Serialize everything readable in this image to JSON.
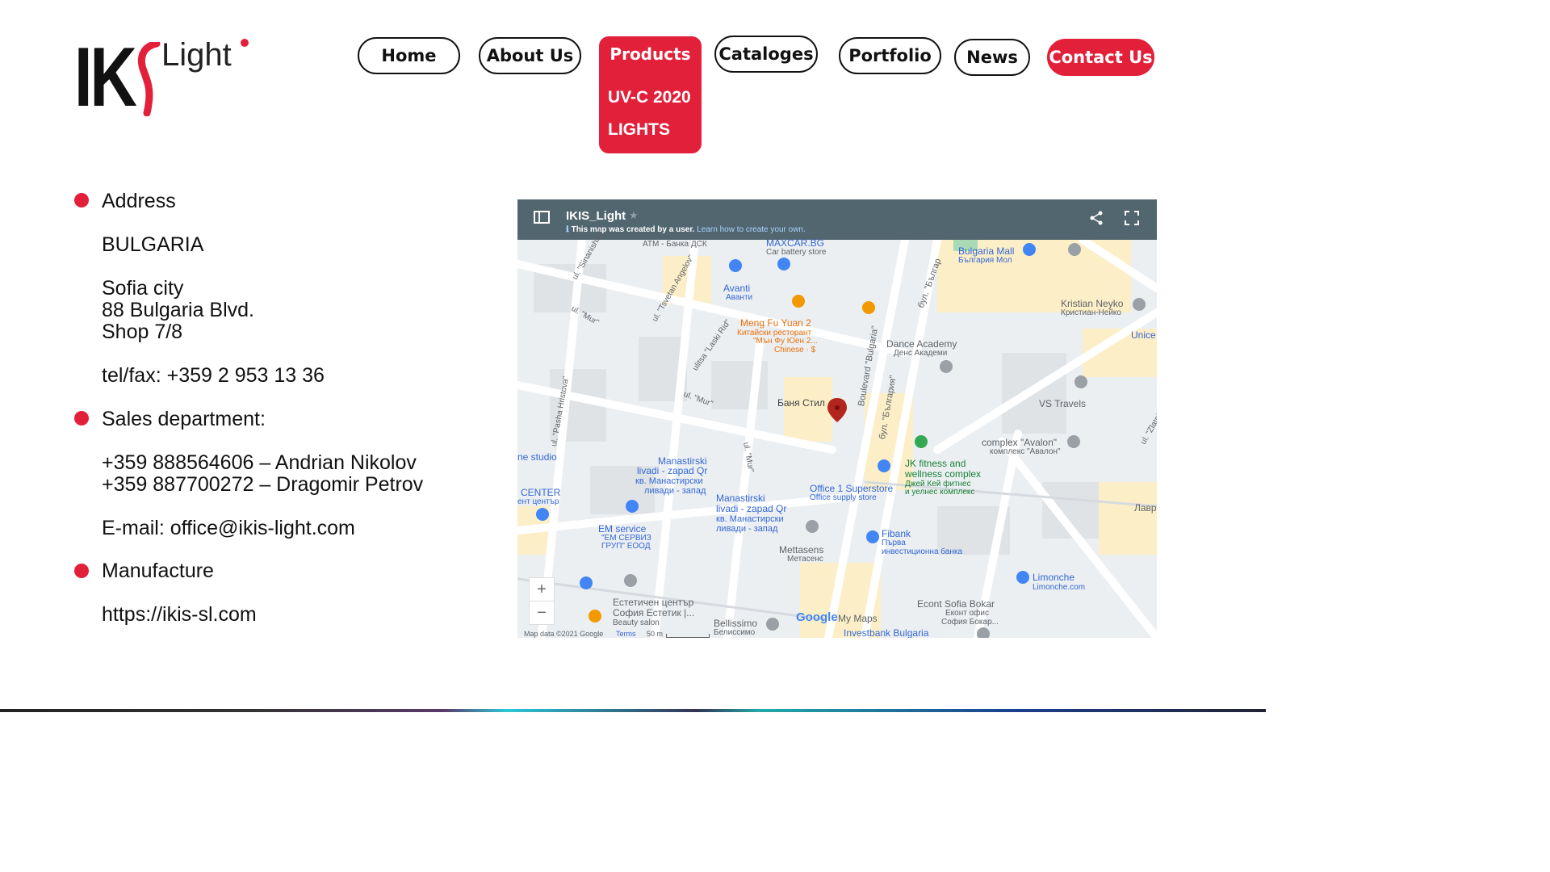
{
  "logo": {
    "ik": "IK",
    "s": "S",
    "light": "Light"
  },
  "nav": {
    "home": "Home",
    "about": "About Us",
    "products": "Products",
    "products_submenu": [
      "UV-C 2020",
      "LIGHTS"
    ],
    "catalogues": "Cataloges",
    "portfolio": "Portfolio",
    "news": "News",
    "contact": "Contact Us"
  },
  "contact": {
    "address_heading": "Address",
    "country": "BULGARIA",
    "city": "Sofia city",
    "street": "88 Bulgaria Blvd.",
    "shop": "Shop 7/8",
    "phone": "tel/fax: +359 2 953 13 36",
    "sales_heading": "Sales department:",
    "sales_1": "+359 888564606 – Andrian Nikolov",
    "sales_2": "+359 887700272 – Dragomir Petrov",
    "email": "E-mail: office@ikis-light.com",
    "manufacture_heading": "Manufacture",
    "manufacture_url": "https://ikis-sl.com"
  },
  "map": {
    "title": "IKIS_Light",
    "subtitle": "This map was created by a user.",
    "subtitle_link": "Learn how to create your own.",
    "zoom_in": "+",
    "zoom_out": "−",
    "footer": "Map data ©2021 Google",
    "terms": "Terms",
    "scale": "50 m",
    "google": "Google",
    "mymaps": "My Maps",
    "pois": {
      "p1": "ATM - Банка ДСК",
      "p2": "MAXCAR.BG",
      "p3": "Car battery store",
      "p4": "Bulgaria Mall",
      "p5": "България Мол",
      "p6": "Avanti",
      "p7": "Аванти",
      "p8": "Meng Fu Yuan 2",
      "p9": "Китайски ресторант",
      "p10": "\"Мън Фу Юен 2...",
      "p11": "Chinese · $",
      "p12": "Kristian Neyko",
      "p13": "Кристиан-Нейко",
      "p14": "Unice",
      "p15": "Dance Academy",
      "p16": "Денс Академи",
      "p17": "Баня Стил",
      "p18": "VS Travels",
      "p19": "Boulevard \"Bulgaria\"",
      "p20": "бул. \"България\"",
      "p21": "complex \"Avalon\"",
      "p22": "комплекс \"Авалон\"",
      "p23": "JK fitness and",
      "p24": "wellness complex",
      "p25": "Джей Кей фитнес",
      "p26": "и уелнес комплекс",
      "p27": "ne studio",
      "p28": "Manastirski",
      "p29": "livadi - zapad Qr",
      "p30": "кв. Манастирски",
      "p31": "ливади - запад",
      "p32": "CENTER",
      "p33": "ент център",
      "p34": "Office 1 Superstore",
      "p35": "Office supply store",
      "p36": "Лавр",
      "p37": "EM service",
      "p38": "\"ЕМ СЕРВИЗ",
      "p39": "ГРУП\" ЕООД",
      "p40": "Fibank",
      "p41": "Първа",
      "p42": "инвестиционна банка",
      "p43": "Mettasens",
      "p44": "Метасенс",
      "p45": "Limonche",
      "p46": "Limonche.com",
      "p47": "Естетичен център",
      "p48": "София Естетик |...",
      "p49": "Beauty salon",
      "p50": "Bellissimo",
      "p51": "Белиссимо",
      "p52": "Econt Sofia Bokar",
      "p53": "Еконт офис",
      "p54": "София Бокар...",
      "p55": "Investbank Bulgaria",
      "p56": "ul. \"Mur\"",
      "p57": "ulitsa \"Laski Rid\"",
      "p58": "ul. \"Pasha Hristova\"",
      "p59": "ul. \"Tsvetan Angelov\"",
      "p60": "ul. \"Sinanishko\"",
      "p61": "бул. \"Българ",
      "p62": "ul. \"Zlatni"
    }
  },
  "colors": {
    "brand_red": "#e3203a",
    "map_header": "#52666f"
  }
}
